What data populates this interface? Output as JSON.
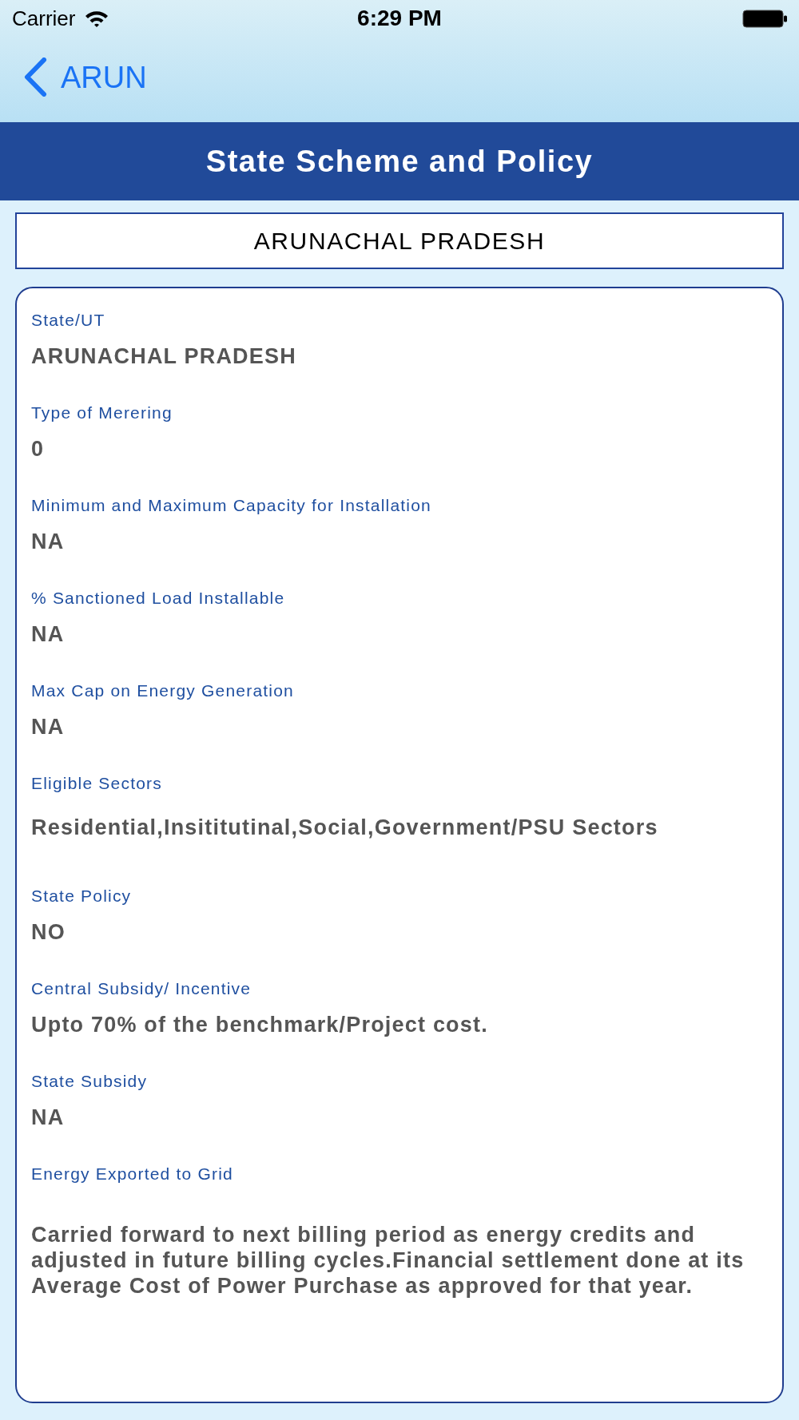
{
  "status_bar": {
    "carrier": "Carrier",
    "time": "6:29 PM"
  },
  "nav_bar": {
    "back_label": "ARUN"
  },
  "header": {
    "title": "State Scheme and Policy"
  },
  "state_selector": {
    "value": "ARUNACHAL PRADESH"
  },
  "details": {
    "fields": [
      {
        "label": "State/UT",
        "value": "ARUNACHAL PRADESH",
        "kind": "line"
      },
      {
        "label": "Type of Merering",
        "value": "0",
        "kind": "line"
      },
      {
        "label": "Minimum and Maximum Capacity for Installation",
        "value": "NA",
        "kind": "line"
      },
      {
        "label": "% Sanctioned Load Installable",
        "value": "NA",
        "kind": "line"
      },
      {
        "label": "Max Cap on Energy Generation",
        "value": "NA",
        "kind": "line"
      },
      {
        "label": "Eligible Sectors",
        "value": "Residential,Insititutinal,Social,Government/PSU Sectors",
        "kind": "textview"
      },
      {
        "label": "State Policy",
        "value": "NO",
        "kind": "line"
      },
      {
        "label": "Central Subsidy/ Incentive",
        "value": "Upto 70% of the benchmark/Project cost.",
        "kind": "line"
      },
      {
        "label": "State Subsidy",
        "value": "NA",
        "kind": "line"
      },
      {
        "label": "Energy Exported to Grid",
        "value": "Carried forward to next billing period as energy credits and adjusted in future billing cycles.Financial settlement done at its Average Cost of Power Purchase as approved for that year.",
        "kind": "textview"
      }
    ]
  }
}
